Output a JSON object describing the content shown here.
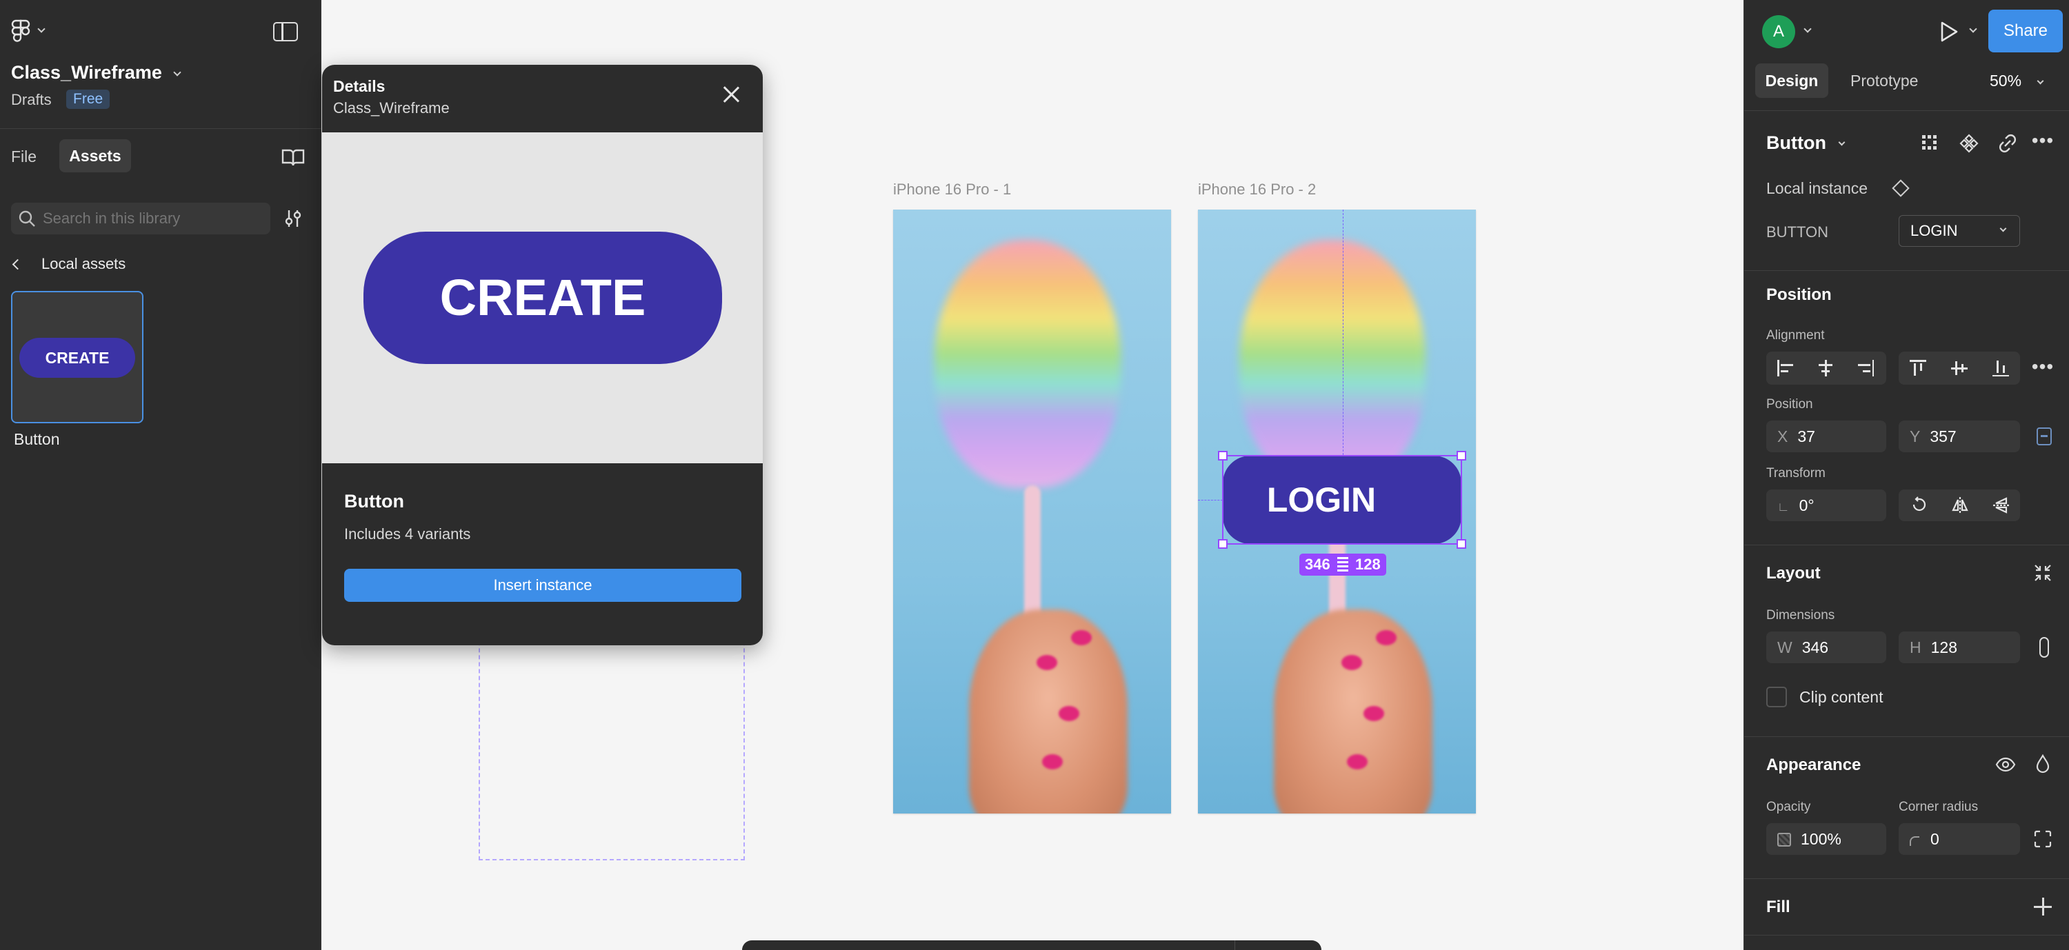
{
  "left_panel": {
    "file_name": "Class_Wireframe",
    "drafts_label": "Drafts",
    "plan_badge": "Free",
    "tabs": [
      {
        "label": "File",
        "active": false
      },
      {
        "label": "Assets",
        "active": true
      }
    ],
    "search_placeholder": "Search in this library",
    "breadcrumb": "Local assets",
    "asset": {
      "thumb_label": "CREATE",
      "name": "Button"
    }
  },
  "details_popover": {
    "title": "Details",
    "subtitle": "Class_Wireframe",
    "preview_label": "CREATE",
    "component_name": "Button",
    "variants_text": "Includes 4 variants",
    "insert_button": "Insert instance"
  },
  "canvas": {
    "frames": [
      {
        "label": "iPhone 16 Pro - 1"
      },
      {
        "label": "iPhone 16 Pro - 2"
      }
    ],
    "selected_button_label": "LOGIN",
    "size_badge": {
      "w": "346",
      "h": "128"
    }
  },
  "right_panel": {
    "avatar_letter": "A",
    "share_label": "Share",
    "tabs": [
      {
        "label": "Design",
        "active": true
      },
      {
        "label": "Prototype",
        "active": false
      }
    ],
    "zoom": "50%",
    "component_name": "Button",
    "local_instance_label": "Local instance",
    "property_name": "BUTTON",
    "property_value": "LOGIN",
    "position": {
      "section_title": "Position",
      "alignment_label": "Alignment",
      "position_label": "Position",
      "x_prefix": "X",
      "x_value": "37",
      "y_prefix": "Y",
      "y_value": "357",
      "transform_label": "Transform",
      "rotation_value": "0°"
    },
    "layout": {
      "section_title": "Layout",
      "dimensions_label": "Dimensions",
      "w_prefix": "W",
      "w_value": "346",
      "h_prefix": "H",
      "h_value": "128",
      "clip_content_label": "Clip content"
    },
    "appearance": {
      "section_title": "Appearance",
      "opacity_label": "Opacity",
      "opacity_value": "100%",
      "corner_radius_label": "Corner radius",
      "corner_radius_value": "0"
    },
    "fill": {
      "section_title": "Fill"
    }
  },
  "colors": {
    "accent_blue": "#0d99ff",
    "share_blue": "#3d8ee8",
    "component_purple": "#3c33a6",
    "selection_purple": "#9747ff",
    "avatar_green": "#1e9e57",
    "panel_bg": "#2c2c2c",
    "canvas_bg": "#f5f5f5"
  }
}
